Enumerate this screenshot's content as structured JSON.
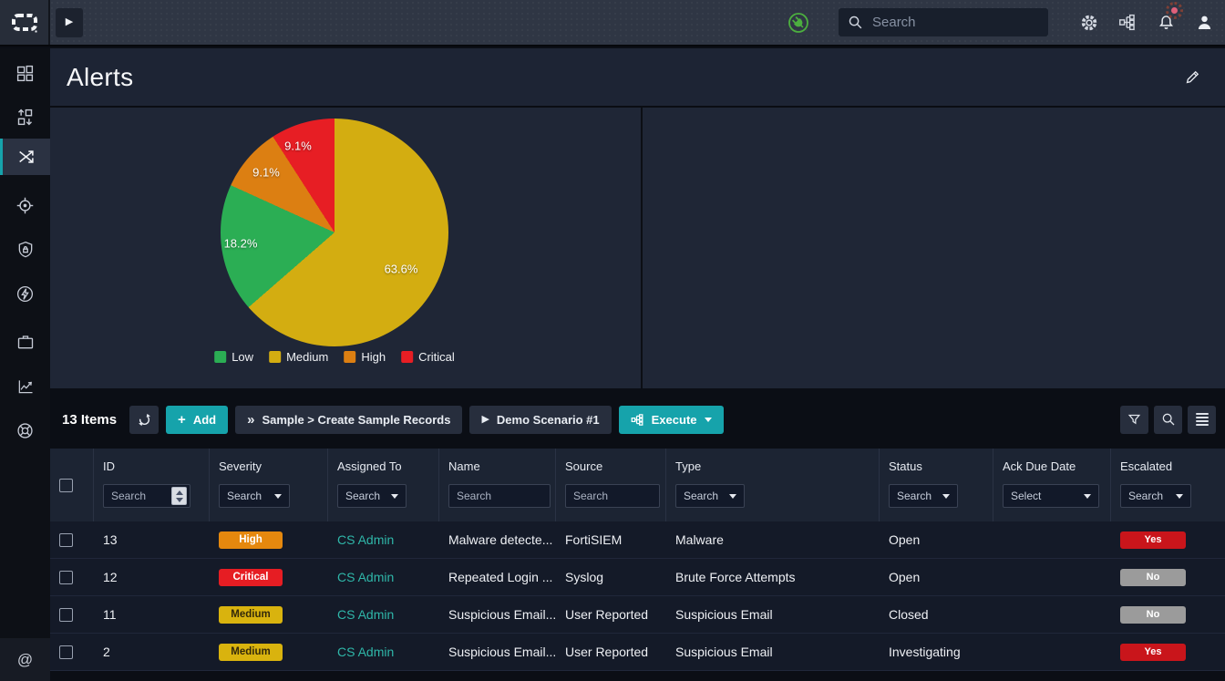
{
  "colors": {
    "accent": "#16a3ab",
    "link": "#2fb7a9",
    "sev_high": "#e5880e",
    "sev_critical": "#e61d23",
    "sev_medium": "#d9b30e",
    "pill_yes": "#c9151b",
    "pill_no": "#9b9b9b",
    "connector_green": "#4caf3f"
  },
  "icons": {
    "plus": "+",
    "chevron_double": "»",
    "play": "▶",
    "at_sign": "@"
  },
  "topbar": {
    "search_placeholder": "Search",
    "icon_names": [
      "fortinet-logo",
      "expand-play",
      "connector-status",
      "search",
      "settings-gear",
      "playbooks",
      "notifications-bell",
      "user-profile"
    ]
  },
  "sidebar": {
    "icon_names": [
      "dashboard",
      "queue-management",
      "incidents-alerts",
      "hunt",
      "security",
      "automation",
      "case-management",
      "reports",
      "threat-intel",
      "mentions"
    ],
    "active_item": "incidents-alerts"
  },
  "page": {
    "title": "Alerts"
  },
  "chart_data": {
    "type": "pie",
    "title": "Alert severity distribution",
    "labels": [
      "Low",
      "Medium",
      "High",
      "Critical"
    ],
    "values": [
      18.2,
      63.6,
      9.1,
      9.1
    ],
    "slice_labels": [
      "18.2%",
      "63.6%",
      "9.1%",
      "9.1%"
    ],
    "colors": [
      "#2bae54",
      "#d3ad11",
      "#dc7f12",
      "#e71e24"
    ],
    "draw_order": [
      1,
      0,
      2,
      3
    ],
    "start_angle_deg": 0,
    "legend_position": "bottom"
  },
  "toolbar": {
    "items_count": "13 Items",
    "add_label": "Add",
    "sample_label": "Sample > Create Sample Records",
    "demo_label": "Demo Scenario #1",
    "execute_label": "Execute"
  },
  "table": {
    "columns": [
      "ID",
      "Severity",
      "Assigned To",
      "Name",
      "Source",
      "Type",
      "Status",
      "Ack Due Date",
      "Escalated"
    ],
    "filters": {
      "id": "Search",
      "severity": "Search",
      "assigned": "Search",
      "name": "Search",
      "source": "Search",
      "type": "Search",
      "status": "Search",
      "ack": "Select",
      "escalated": "Search"
    },
    "rows": [
      {
        "id": "13",
        "severity": "High",
        "assigned": "CS Admin",
        "name": "Malware detecte...",
        "source": "FortiSIEM",
        "type": "Malware",
        "status": "Open",
        "ack": "",
        "escalated": "Yes"
      },
      {
        "id": "12",
        "severity": "Critical",
        "assigned": "CS Admin",
        "name": "Repeated Login ...",
        "source": "Syslog",
        "type": "Brute Force Attempts",
        "status": "Open",
        "ack": "",
        "escalated": "No"
      },
      {
        "id": "11",
        "severity": "Medium",
        "assigned": "CS Admin",
        "name": "Suspicious Email...",
        "source": "User Reported",
        "type": "Suspicious Email",
        "status": "Closed",
        "ack": "",
        "escalated": "No"
      },
      {
        "id": "2",
        "severity": "Medium",
        "assigned": "CS Admin",
        "name": "Suspicious Email...",
        "source": "User Reported",
        "type": "Suspicious Email",
        "status": "Investigating",
        "ack": "",
        "escalated": "Yes"
      }
    ]
  }
}
